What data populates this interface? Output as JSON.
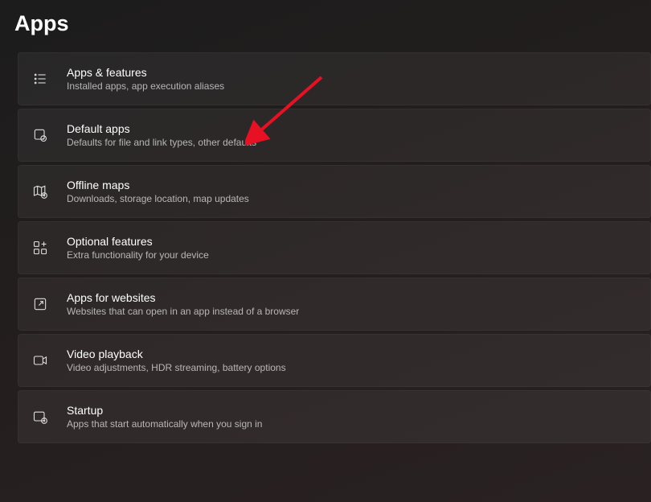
{
  "page": {
    "title": "Apps"
  },
  "items": [
    {
      "title": "Apps & features",
      "subtitle": "Installed apps, app execution aliases"
    },
    {
      "title": "Default apps",
      "subtitle": "Defaults for file and link types, other defaults"
    },
    {
      "title": "Offline maps",
      "subtitle": "Downloads, storage location, map updates"
    },
    {
      "title": "Optional features",
      "subtitle": "Extra functionality for your device"
    },
    {
      "title": "Apps for websites",
      "subtitle": "Websites that can open in an app instead of a browser"
    },
    {
      "title": "Video playback",
      "subtitle": "Video adjustments, HDR streaming, battery options"
    },
    {
      "title": "Startup",
      "subtitle": "Apps that start automatically when you sign in"
    }
  ]
}
